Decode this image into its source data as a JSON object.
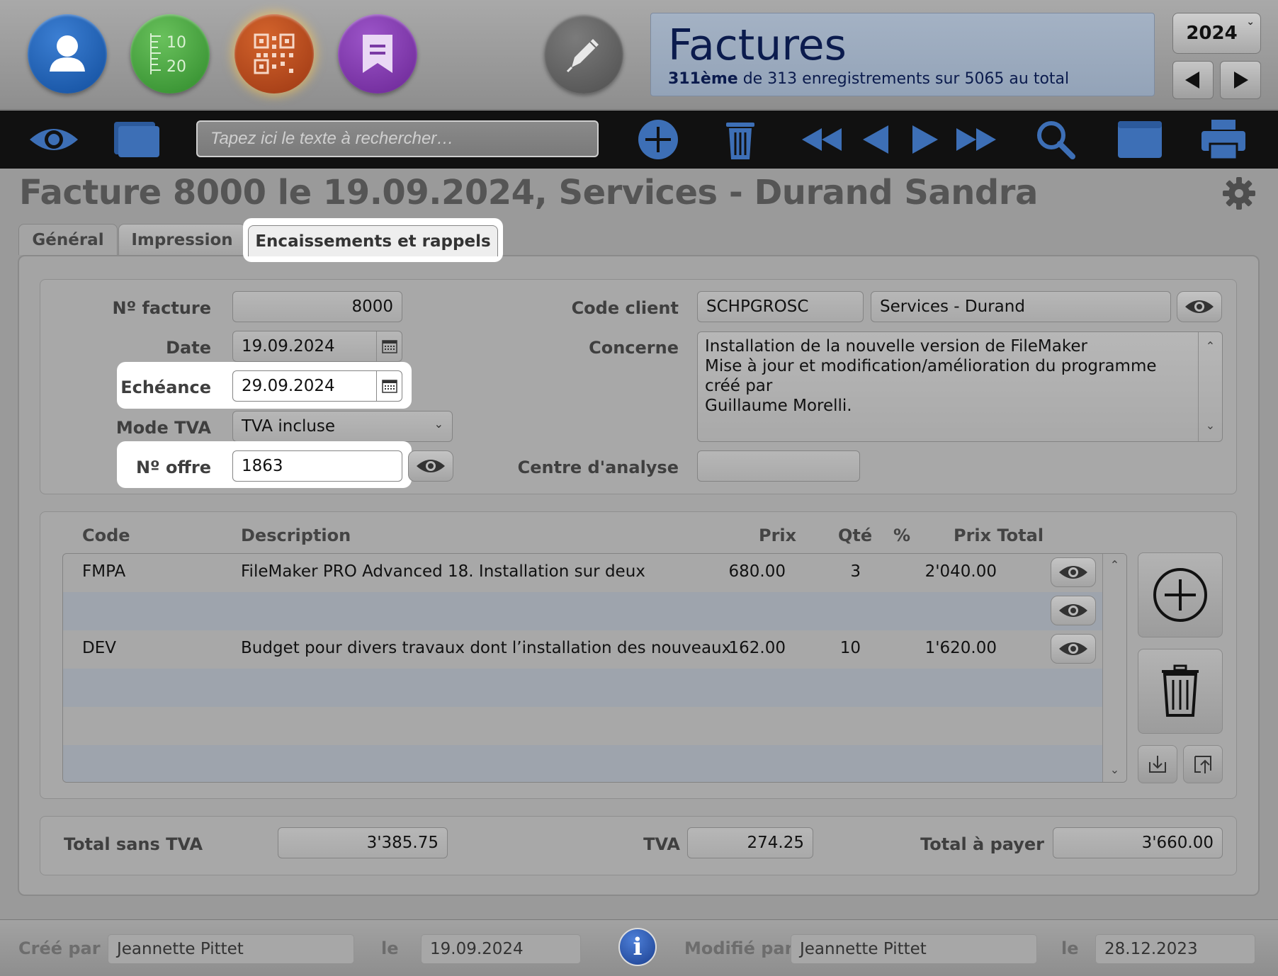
{
  "header": {
    "app_title": "Factures",
    "record_info_rank": "311ème",
    "record_info_rest": " de 313 enregistrements sur 5065 au total",
    "year": "2024",
    "buttons": [
      "contacts-icon",
      "numbers-icon",
      "qr-code-icon",
      "bookmark-icon",
      "pen-icon"
    ]
  },
  "toolbar": {
    "search_placeholder": "Tapez ici le texte à rechercher…",
    "icons": [
      "eye-icon",
      "layout-icon",
      "add-icon",
      "trash-icon",
      "first-record-icon",
      "previous-record-icon",
      "next-record-icon",
      "last-record-icon",
      "search-icon",
      "window-icon",
      "print-icon"
    ]
  },
  "page": {
    "title": "Facture 8000 le 19.09.2024, Services - Durand Sandra"
  },
  "tabs": {
    "general": "Général",
    "impression": "Impression",
    "encaissements": "Encaissements et rappels",
    "active": "encaissements"
  },
  "form": {
    "no_facture_label": "Nº facture",
    "no_facture": "8000",
    "date_label": "Date",
    "date": "19.09.2024",
    "echeance_label": "Echéance",
    "echeance": "29.09.2024",
    "mode_tva_label": "Mode TVA",
    "mode_tva": "TVA incluse",
    "no_offre_label": "Nº offre",
    "no_offre": "1863",
    "code_client_label": "Code client",
    "code_client": "SCHPGROSC",
    "client_name": "Services - Durand",
    "concerne_label": "Concerne",
    "concerne_line1": "Installation de la nouvelle version de FileMaker",
    "concerne_line2": "Mise à jour et modification/amélioration du programme créé par",
    "concerne_line3": "Guillaume Morelli.",
    "centre_label": "Centre d'analyse",
    "centre": ""
  },
  "items": {
    "headers": {
      "code": "Code",
      "description": "Description",
      "prix": "Prix",
      "qte": "Qté",
      "pct": "%",
      "total": "Prix Total"
    },
    "rows": [
      {
        "code": "FMPA",
        "description": "FileMaker PRO Advanced 18. Installation sur deux",
        "prix": "680.00",
        "qte": "3",
        "pct": "",
        "total": "2'040.00"
      },
      {
        "code": "",
        "description": "",
        "prix": "",
        "qte": "",
        "pct": "",
        "total": ""
      },
      {
        "code": "DEV",
        "description": "Budget pour divers travaux dont l’installation des nouveaux",
        "prix": "162.00",
        "qte": "10",
        "pct": "",
        "total": "1'620.00"
      }
    ]
  },
  "totals": {
    "sans_tva_label": "Total sans TVA",
    "sans_tva": "3'385.75",
    "tva_label": "TVA",
    "tva": "274.25",
    "a_payer_label": "Total à payer",
    "a_payer": "3'660.00"
  },
  "footer": {
    "cree_par_label": "Créé par",
    "cree_par": "Jeannette Pittet",
    "le_label": "le",
    "cree_le": "19.09.2024",
    "modifie_par_label": "Modifié par",
    "modifie_par": "Jeannette Pittet",
    "modifie_le": "28.12.2023",
    "info": "i"
  }
}
